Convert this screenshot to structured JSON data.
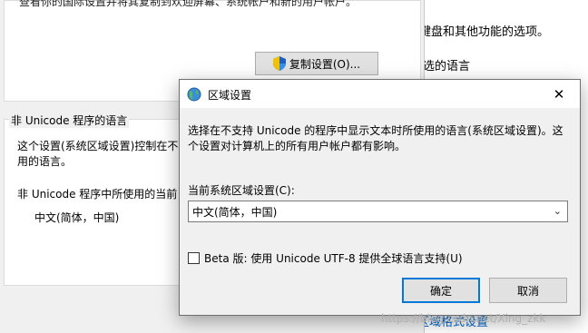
{
  "background_window": {
    "right_text_1": "键盘和其他功能的选项。",
    "right_text_2": "选的语言",
    "right_link": "区域格式设置"
  },
  "background_dialog": {
    "top_text": "查看你的国际设置并将其复制到欢迎屏幕、系统帐户和新的用户帐户。",
    "copy_button": "复制设置(O)...",
    "group_label": "非 Unicode 程序的语言",
    "line_1": "这个设置(系统区域设置)控制在不",
    "line_2": "用的语言。",
    "line_3": "非 Unicode 程序中所使用的当前",
    "current_value": "中文(简体，中国)"
  },
  "dialog": {
    "title": "区域设置",
    "close_glyph": "✕",
    "description": "选择在不支持 Unicode 的程序中显示文本时所使用的语言(系统区域设置)。这个设置对计算机上的所有用户帐户都有影响。",
    "field_label": "当前系统区域设置(C):",
    "selected_locale": "中文(简体，中国)",
    "checkbox_label": "Beta 版: 使用 Unicode UTF-8 提供全球语言支持(U)",
    "checkbox_checked": false,
    "ok_button": "确定",
    "cancel_button": "取消"
  },
  "watermark": "https://blog.csdn.net/Xing_zkk",
  "colors": {
    "accent": "#0078d7",
    "link": "#0066cc"
  }
}
